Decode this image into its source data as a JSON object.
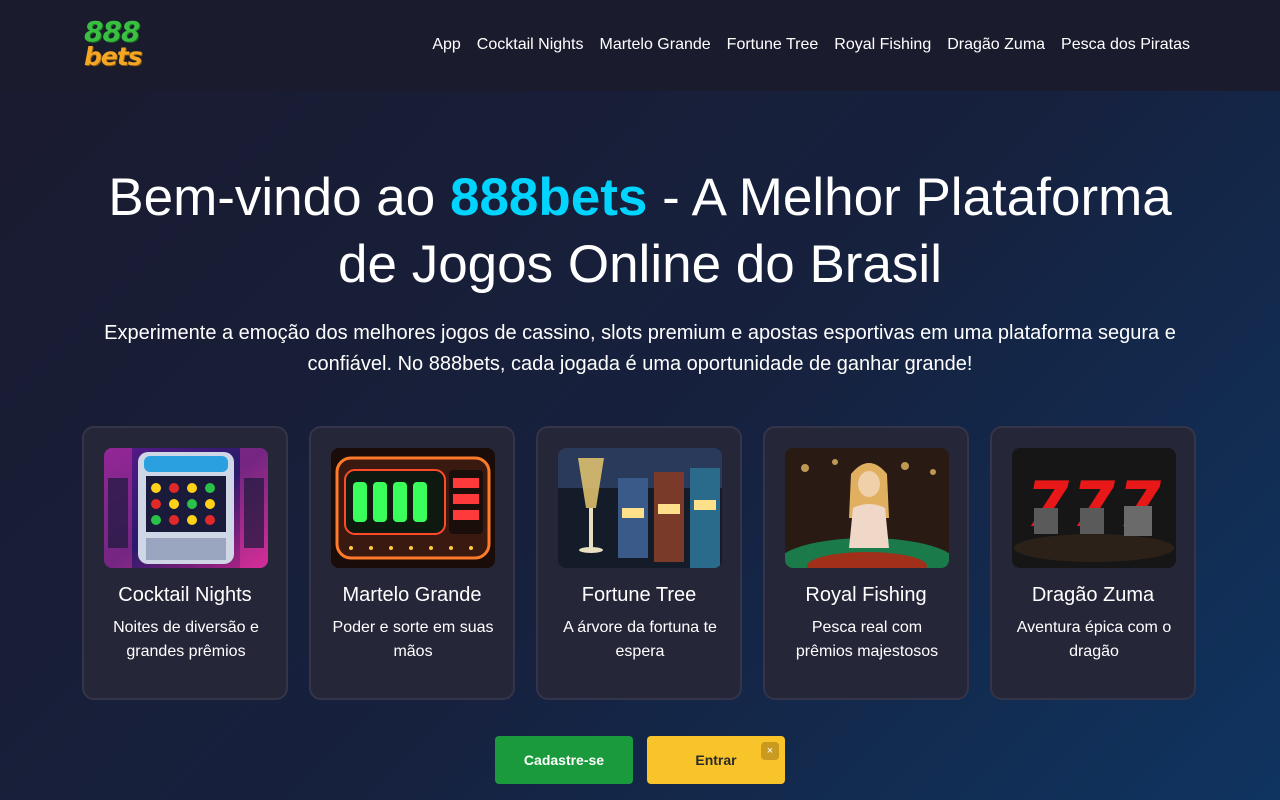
{
  "header": {
    "logo_top": "888",
    "logo_bottom": "bets",
    "nav": [
      "App",
      "Cocktail Nights",
      "Martelo Grande",
      "Fortune Tree",
      "Royal Fishing",
      "Dragão Zuma",
      "Pesca dos Piratas"
    ]
  },
  "hero": {
    "title_before": "Bem-vindo ao ",
    "title_brand": "888bets",
    "title_after": " - A Melhor Plataforma de Jogos Online do Brasil",
    "subtitle": "Experimente a emoção dos melhores jogos de cassino, slots premium e apostas esportivas em uma plataforma segura e confiável. No 888bets, cada jogada é uma oportunidade de ganhar grande!"
  },
  "games": [
    {
      "title": "Cocktail Nights",
      "desc": "Noites de diversão e grandes prêmios",
      "image": "slot-machine-diamond-hits"
    },
    {
      "title": "Martelo Grande",
      "desc": "Poder e sorte em suas mãos",
      "image": "neon-slot-sign"
    },
    {
      "title": "Fortune Tree",
      "desc": "A árvore da fortuna te espera",
      "image": "champagne-casino-slots"
    },
    {
      "title": "Royal Fishing",
      "desc": "Pesca real com prêmios majestosos",
      "image": "woman-roulette-table"
    },
    {
      "title": "Dragão Zuma",
      "desc": "Aventura épica com o dragão",
      "image": "red-777-slot"
    }
  ],
  "actions": {
    "register": "Cadastre-se",
    "login": "Entrar",
    "close": "×"
  },
  "colors": {
    "brand_accent": "#00d4ff",
    "register_button": "#1a9a3c",
    "login_button": "#f8c42a",
    "card_background": "#262639"
  }
}
